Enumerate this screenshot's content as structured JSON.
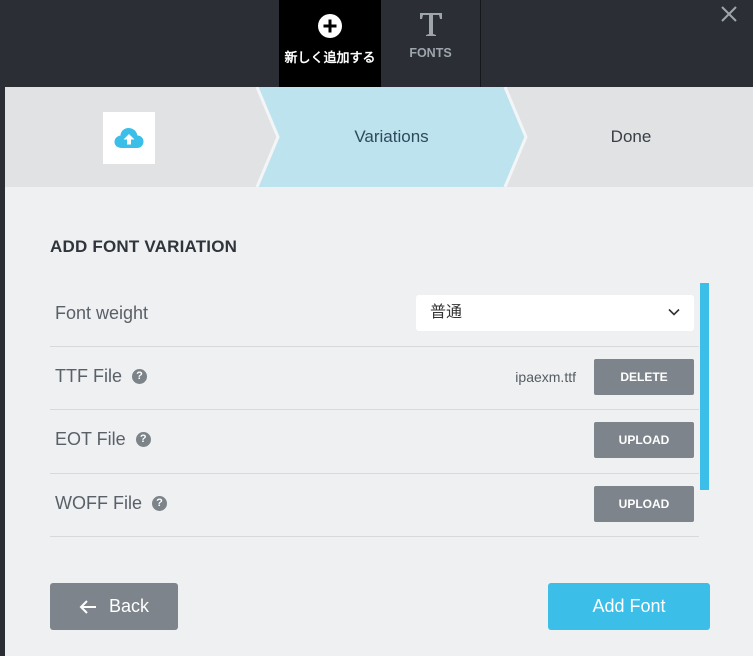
{
  "colors": {
    "topbar": "#2b2f35",
    "accent": "#3bbfe9",
    "button_grey": "#7d848b",
    "step_active": "#bde3ef",
    "step_inactive": "#e0e2e4"
  },
  "top_tabs": [
    {
      "label": "新しく追加する",
      "icon": "plus-circle-icon",
      "active": true
    },
    {
      "label": "FONTS",
      "icon": "text-t-icon",
      "active": false
    }
  ],
  "close_icon": "close-icon",
  "steps": [
    {
      "icon": "cloud-upload-icon",
      "label": ""
    },
    {
      "label": "Variations",
      "active": true
    },
    {
      "label": "Done"
    }
  ],
  "section_title": "ADD FONT VARIATION",
  "font_weight": {
    "label": "Font weight",
    "value": "普通"
  },
  "ttf": {
    "label": "TTF File",
    "filename": "ipaexm.ttf",
    "button": "DELETE"
  },
  "eot": {
    "label": "EOT File",
    "button": "UPLOAD"
  },
  "woff": {
    "label": "WOFF File",
    "button": "UPLOAD"
  },
  "help_glyph": "?",
  "footer": {
    "back_label": "Back",
    "add_label": "Add Font"
  }
}
